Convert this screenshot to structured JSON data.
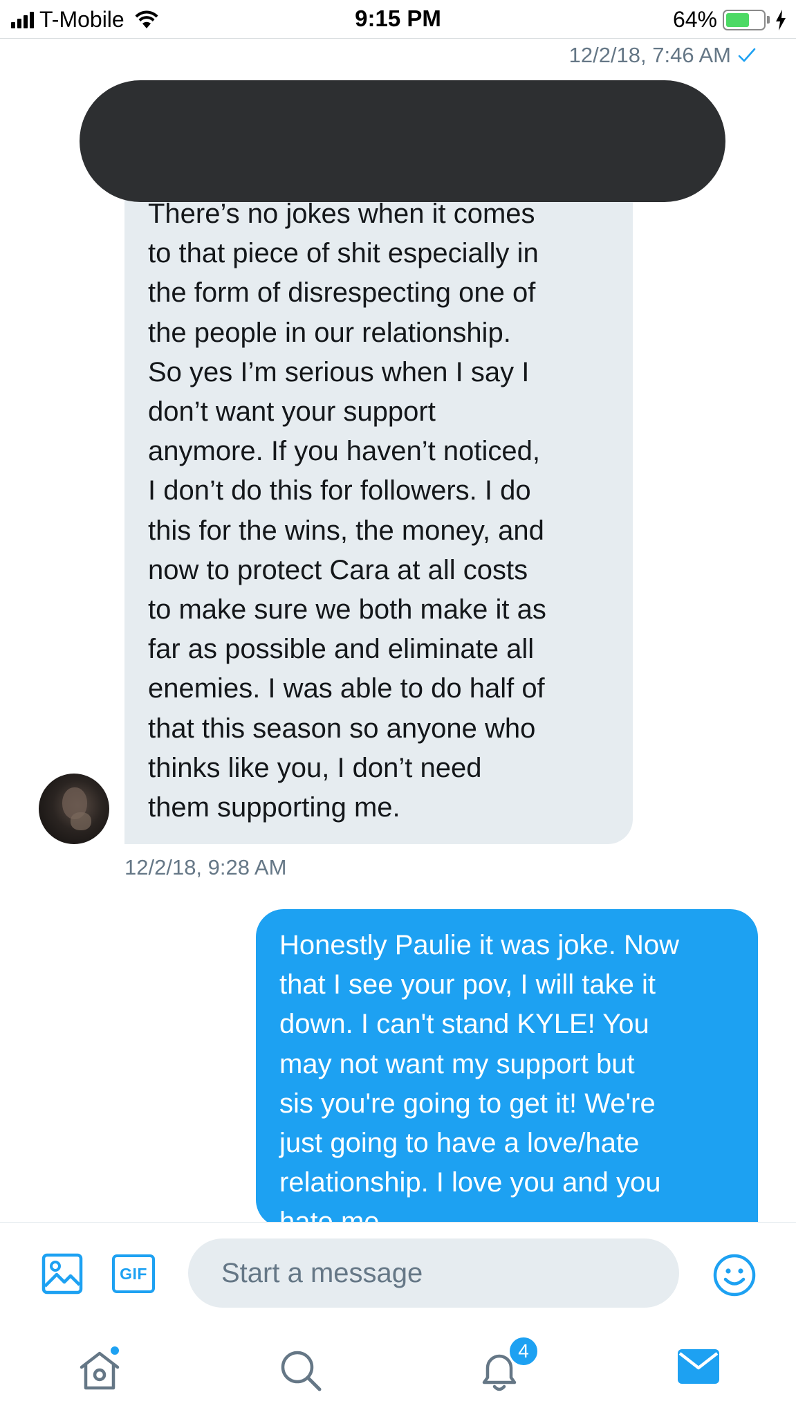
{
  "status_bar": {
    "carrier": "T-Mobile",
    "time": "9:15 PM",
    "battery_percent": "64%",
    "battery_level": 0.64,
    "charging": true,
    "signal_bars": 4
  },
  "conversation": {
    "timestamp_top": "12/2/18, 7:46 AM",
    "read_receipt_icon": "checkmark-icon",
    "redacted": true,
    "incoming_message": "There’s no jokes when it comes\nto that piece of shit especially in\nthe form of disrespecting one of\nthe people in our relationship.\nSo yes I’m serious when I say I\ndon’t want your support\nanymore. If you haven’t noticed,\nI don’t do this for followers. I do\nthis for the wins, the money, and\nnow to protect Cara at all costs\nto make sure we both make it as\nfar as possible and eliminate all\nenemies. I was able to do half of\nthat this season so anyone who\nthinks like you, I don’t need\nthem supporting me.",
    "incoming_timestamp": "12/2/18, 9:28 AM",
    "outgoing_message": "Honestly Paulie it was joke. Now\nthat I see your pov, I will take it\ndown. I can't stand KYLE! You\nmay not want my support but\nsis you're going to get it! We're\njust going to have a love/hate\nrelationship. I love you and you\nhate me."
  },
  "composer": {
    "gif_label": "GIF",
    "placeholder": "Start a message",
    "icons": [
      "image-icon",
      "gif-icon",
      "emoji-icon"
    ]
  },
  "tab_bar": {
    "icons": [
      "home-icon",
      "search-icon",
      "notifications-icon",
      "messages-icon"
    ],
    "notifications_badge": "4",
    "home_has_new": true,
    "active_tab": "messages"
  },
  "colors": {
    "accent": "#1da1f2",
    "incoming_bubble": "#e6ecf0",
    "secondary_text": "#657786",
    "battery_green": "#4cd964"
  }
}
